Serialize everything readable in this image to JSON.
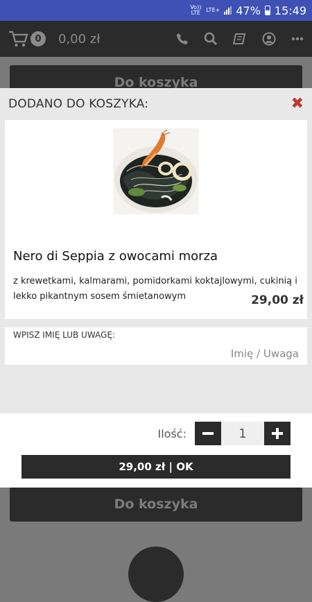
{
  "status_bar": {
    "volte_label": "Vo)) LTE",
    "lte_label": "LTE+",
    "battery": "47%",
    "time": "15:49"
  },
  "header": {
    "cart_count": "0",
    "cart_total": "0,00 zł"
  },
  "behind": {
    "top_button": "Do koszyka",
    "bottom_button": "Do koszyka"
  },
  "modal": {
    "title": "DODANO DO KOSZYKA:",
    "item": {
      "name": "Nero di Seppia z owocami morza",
      "description": "z krewetkami, kalmarami, pomidorkami koktajlowymi, cukinią i lekko pikantnym sosem śmietanowym",
      "price": "29,00 zł"
    },
    "note": {
      "label": "WPISZ IMIĘ LUB UWAGĘ:",
      "placeholder": "Imię / Uwaga"
    },
    "quantity": {
      "label": "Ilość:",
      "value": "1"
    },
    "ok_button": "29,00 zł | OK"
  },
  "colors": {
    "accent_dark": "#2b2b2b",
    "status_bar": "#3f51b5",
    "close": "#c0392b"
  }
}
